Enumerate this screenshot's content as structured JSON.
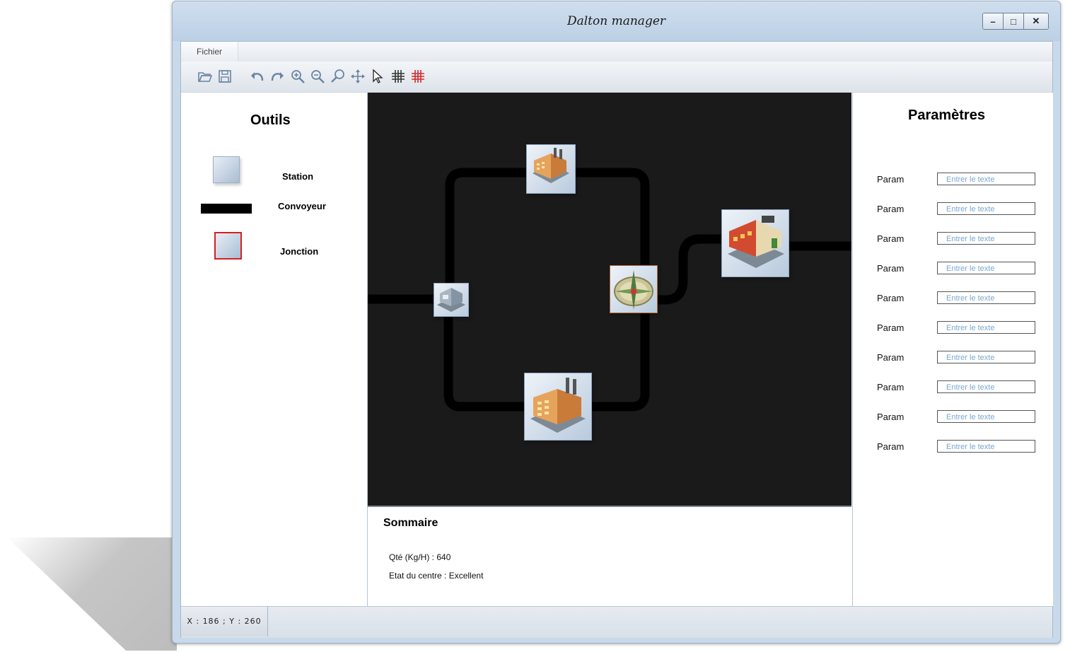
{
  "window": {
    "title": "Dalton manager",
    "controls": {
      "minimize": "–",
      "maximize": "□",
      "close": "✕"
    }
  },
  "menu": {
    "items": [
      {
        "label": "Fichier"
      }
    ]
  },
  "toolbar": {
    "icons": [
      "open-folder-icon",
      "save-icon",
      "undo-icon",
      "redo-icon",
      "zoom-in-icon",
      "zoom-out-icon",
      "search-icon",
      "move-icon",
      "pointer-icon",
      "grid-icon",
      "grid-red-icon"
    ]
  },
  "tools": {
    "title": "Outils",
    "items": [
      {
        "label": "Station"
      },
      {
        "label": "Convoyeur"
      },
      {
        "label": "Jonction"
      }
    ]
  },
  "params": {
    "title": "Paramètres",
    "rows": [
      {
        "label": "Param",
        "placeholder": "Entrer le texte"
      },
      {
        "label": "Param",
        "placeholder": "Entrer le texte"
      },
      {
        "label": "Param",
        "placeholder": "Entrer le texte"
      },
      {
        "label": "Param",
        "placeholder": "Entrer le texte"
      },
      {
        "label": "Param",
        "placeholder": "Entrer le texte"
      },
      {
        "label": "Param",
        "placeholder": "Entrer le texte"
      },
      {
        "label": "Param",
        "placeholder": "Entrer le texte"
      },
      {
        "label": "Param",
        "placeholder": "Entrer le texte"
      },
      {
        "label": "Param",
        "placeholder": "Entrer le texte"
      },
      {
        "label": "Param",
        "placeholder": "Entrer le texte"
      }
    ]
  },
  "summary": {
    "title": "Sommaire",
    "quantity": "Qté (Kg/H) : 640",
    "state": "Etat du centre : Excellent"
  },
  "status": {
    "coords": "X : 186 ; Y : 260"
  },
  "colors": {
    "accent": "#c8d9ea",
    "junction_border": "#d42020",
    "placeholder": "#7aa7cf"
  }
}
